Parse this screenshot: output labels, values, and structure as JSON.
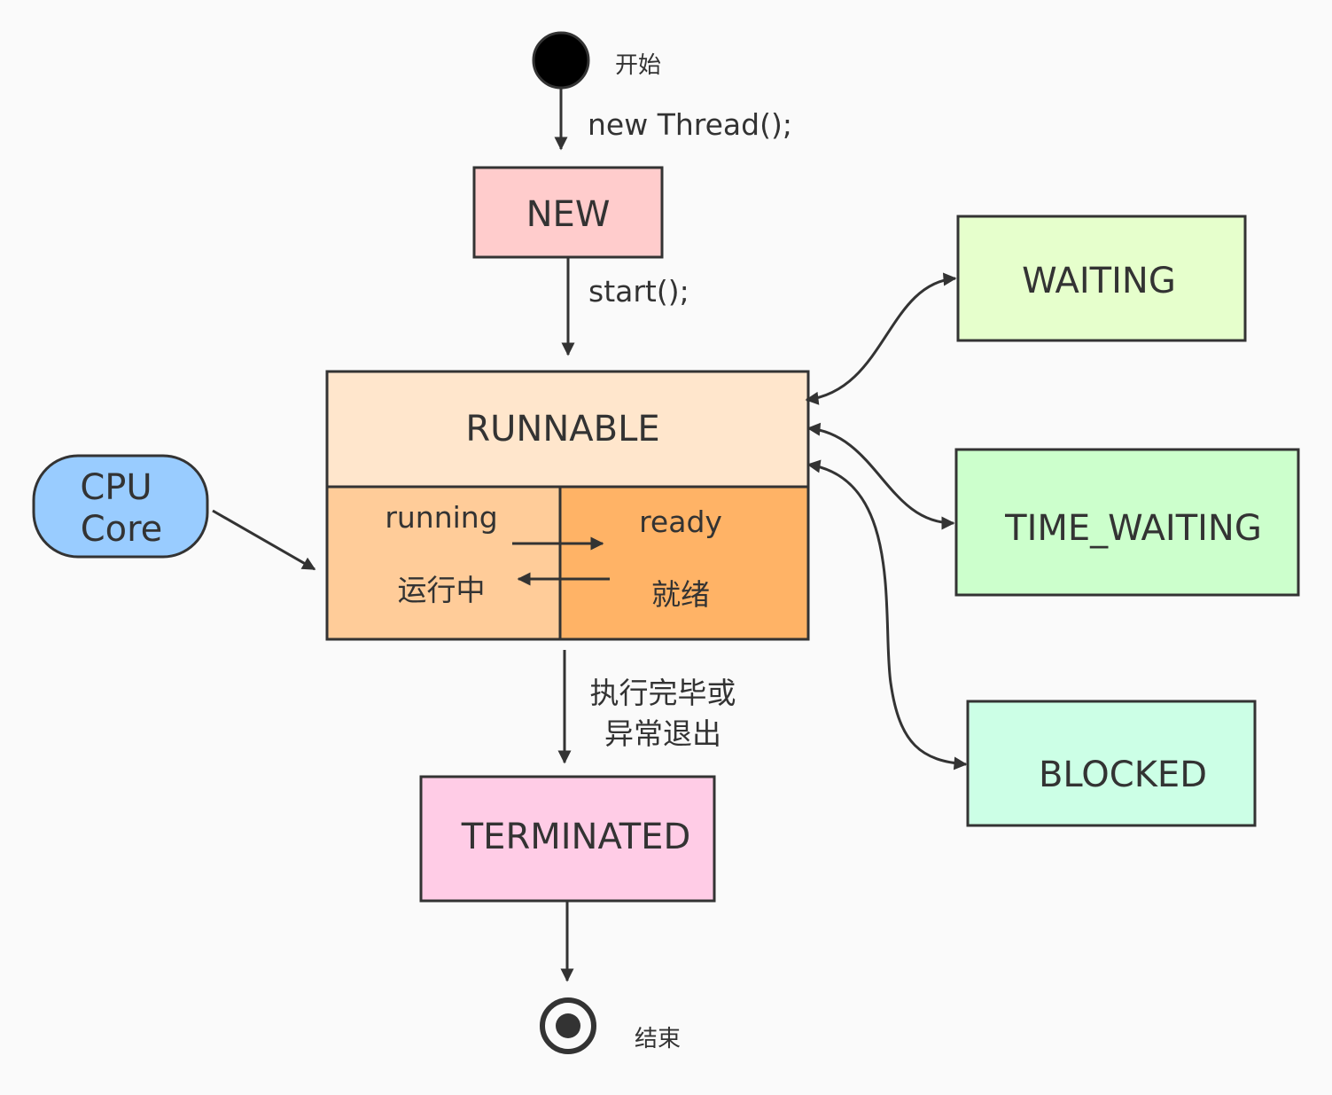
{
  "title": "",
  "colors": {
    "background": "#fafafa",
    "stroke": "#333333",
    "new": "#ffcccc",
    "runnable": "#ffe6cc",
    "running": "#ffcc99",
    "ready": "#ffb366",
    "waiting": "#e6ffcc",
    "time_waiting": "#ccffcc",
    "blocked": "#ccffe6",
    "terminated": "#ffcce6",
    "cpu": "#99ccff"
  },
  "nodes": {
    "start": {
      "label": "开始"
    },
    "new": {
      "label": "NEW"
    },
    "runnable": {
      "label": "RUNNABLE"
    },
    "running": {
      "label": "running",
      "sublabel": "运行中"
    },
    "ready": {
      "label": "ready",
      "sublabel": "就绪"
    },
    "cpu": {
      "line1": "CPU",
      "line2": "Core"
    },
    "waiting": {
      "label": "WAITING"
    },
    "time_waiting": {
      "label": "TIME_WAITING"
    },
    "blocked": {
      "label": "BLOCKED"
    },
    "terminated": {
      "label": "TERMINATED"
    },
    "end": {
      "label": "结束"
    }
  },
  "edges": {
    "start_new": "new Thread();",
    "new_runnable": "start();",
    "runnable_terminated_line1": "执行完毕或",
    "runnable_terminated_line2": "异常退出"
  }
}
